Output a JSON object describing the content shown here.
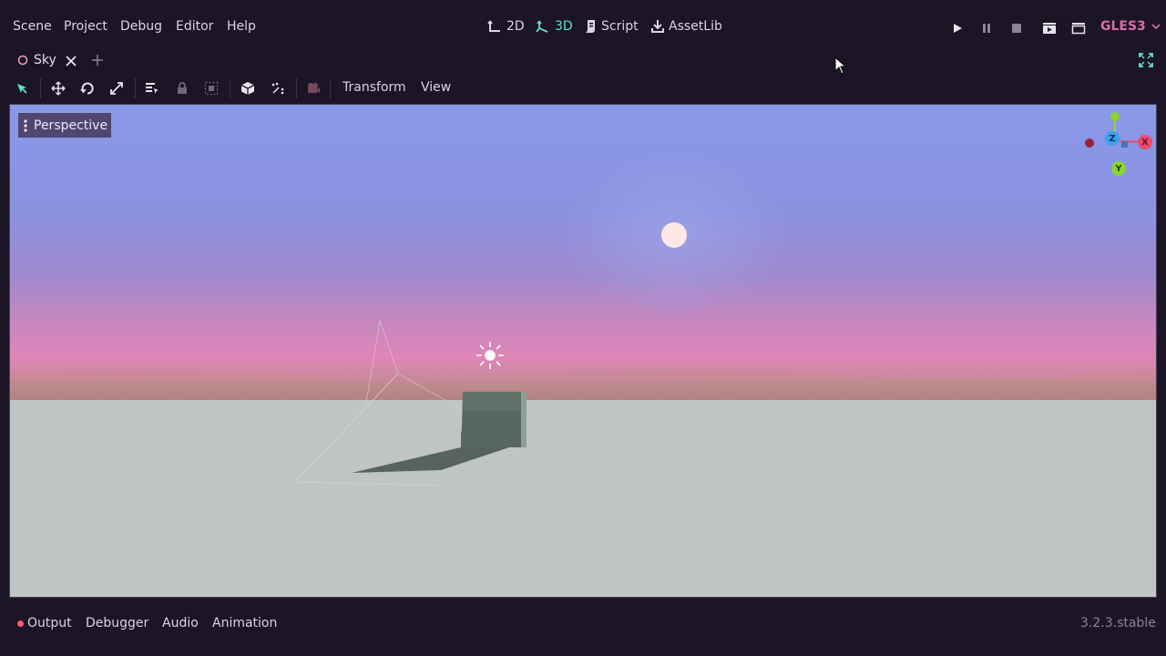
{
  "menu": {
    "scene": "Scene",
    "project": "Project",
    "debug": "Debug",
    "editor": "Editor",
    "help": "Help"
  },
  "workspaces": {
    "ws_2d": "2D",
    "ws_3d": "3D",
    "script": "Script",
    "assetlib": "AssetLib",
    "active": "3D"
  },
  "renderer": {
    "label": "GLES3"
  },
  "tabs": {
    "scene_tab": "Sky"
  },
  "toolbar": {
    "transform": "Transform",
    "view": "View"
  },
  "viewport": {
    "perspective_label": "Perspective",
    "gizmo": {
      "x": "X",
      "y": "Y",
      "z": "Z"
    }
  },
  "bottom_panel": {
    "output": "Output",
    "debugger": "Debugger",
    "audio": "Audio",
    "animation": "Animation",
    "version": "3.2.3.stable"
  },
  "colors": {
    "background": "#1b1526",
    "accent": "#62e0c6",
    "renderer_label": "#d46ea8",
    "output_dot": "#ff5d6c",
    "gizmo_x": "#f04a6a",
    "gizmo_y": "#8ad433",
    "gizmo_z": "#3d9ff0"
  }
}
